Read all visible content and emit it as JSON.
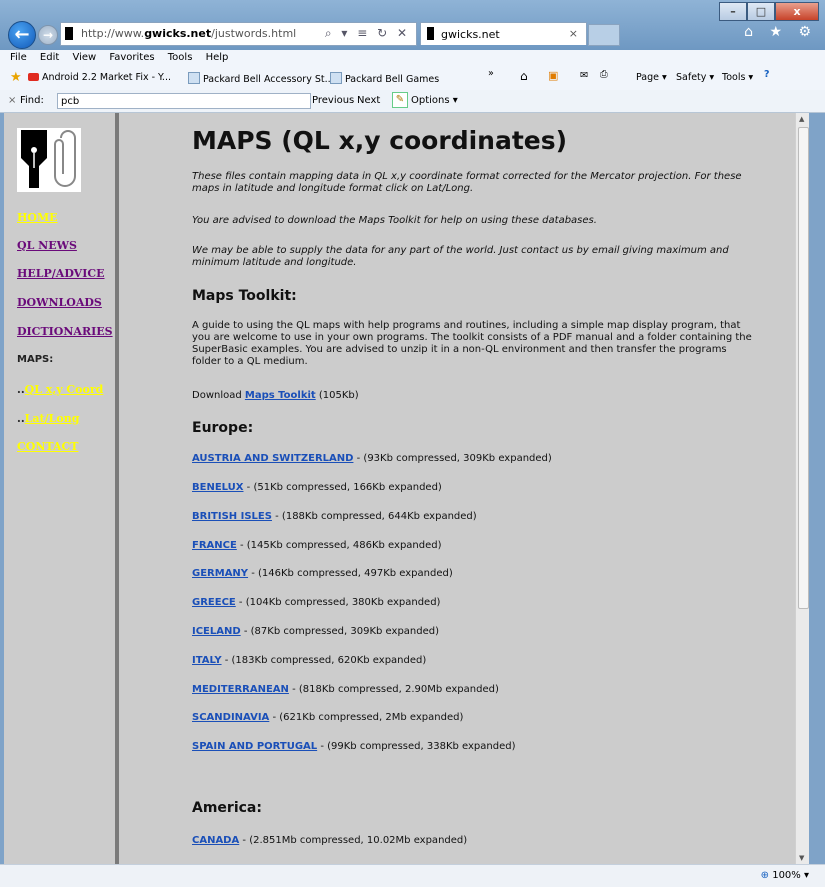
{
  "browser": {
    "address": {
      "prefix": "http://www.",
      "domain": "gwicks.net",
      "path": "/justwords.html",
      "controls": "⌕ ▾ ≡ ↻ ✕"
    },
    "tab_title": "gwicks.net",
    "tab_close": "×",
    "window_buttons": {
      "minimize": "–",
      "maximize": "□",
      "close": "x"
    },
    "toolbar_icons": "⌂ ★ ⚙"
  },
  "menu": [
    "File",
    "Edit",
    "View",
    "Favorites",
    "Tools",
    "Help"
  ],
  "favorites": {
    "items": [
      "Android 2.2 Market Fix - Y...",
      "Packard Bell Accessory St...",
      "Packard Bell Games"
    ],
    "command_bar": [
      "Page ▾",
      "Safety ▾",
      "Tools ▾"
    ],
    "overflow": "»"
  },
  "find": {
    "label": "Find:",
    "value": "pcb",
    "previous": "Previous",
    "next": "Next",
    "options": "Options ▾",
    "close": "×"
  },
  "sidebar": {
    "items": [
      {
        "label": "HOME",
        "style": "yl"
      },
      {
        "label": "QL NEWS",
        "style": "pu"
      },
      {
        "label": "HELP/ADVICE",
        "style": "pu"
      },
      {
        "label": "DOWNLOADS",
        "style": "pu"
      },
      {
        "label": "DICTIONARIES",
        "style": "pu"
      },
      {
        "label": "MAPS:",
        "style": "bk"
      },
      {
        "label": "QL x,y Coord",
        "prefix": "..",
        "style": "yl"
      },
      {
        "label": "Lat/Long",
        "prefix": "..",
        "style": "yl"
      },
      {
        "label": "CONTACT",
        "style": "yl"
      }
    ]
  },
  "page": {
    "title": "MAPS (QL x,y coordinates)",
    "intro1": "These files contain mapping data in QL x,y coordinate format corrected for the Mercator projection. For these maps in latitude and longitude format click on Lat/Long.",
    "intro2": "You are advised to download the Maps Toolkit for help on using these databases.",
    "intro3": "We may be able to supply the data for any part of the world. Just contact us by email giving maximum and minimum latitude and longitude.",
    "toolkit_heading": "Maps Toolkit:",
    "toolkit_text": "A guide to using the QL maps with help programs and routines, including a simple map display program, that you are welcome to use in your own programs. The toolkit consists of a PDF manual and a folder containing the SuperBasic examples. You are advised to unzip it in a non-QL environment and then transfer the programs folder to a QL medium.",
    "download_prefix": "Download ",
    "download_link": "Maps Toolkit",
    "download_size": " (105Kb)",
    "europe_heading": "Europe:",
    "europe": [
      {
        "name": "AUSTRIA AND SWITZERLAND",
        "info": " - (93Kb compressed, 309Kb expanded)"
      },
      {
        "name": "BENELUX",
        "info": " - (51Kb compressed, 166Kb expanded)"
      },
      {
        "name": "BRITISH ISLES",
        "info": " - (188Kb compressed, 644Kb expanded)"
      },
      {
        "name": "FRANCE",
        "info": " - (145Kb compressed, 486Kb expanded)"
      },
      {
        "name": "GERMANY",
        "info": " - (146Kb compressed, 497Kb expanded)"
      },
      {
        "name": "GREECE",
        "info": " - (104Kb compressed, 380Kb expanded)"
      },
      {
        "name": "ICELAND",
        "info": " - (87Kb compressed, 309Kb expanded)"
      },
      {
        "name": "ITALY",
        "info": " - (183Kb compressed, 620Kb expanded)"
      },
      {
        "name": "MEDITERRANEAN",
        "info": " - (818Kb compressed, 2.90Mb expanded)"
      },
      {
        "name": "SCANDINAVIA",
        "info": " - (621Kb compressed, 2Mb expanded)"
      },
      {
        "name": "SPAIN AND PORTUGAL",
        "info": " - (99Kb compressed, 338Kb expanded)"
      }
    ],
    "america_heading": "America:",
    "america": [
      {
        "name": "CANADA",
        "info": " - (2.851Mb compressed, 10.02Mb expanded)"
      }
    ]
  },
  "status": {
    "zoom": "100%"
  }
}
